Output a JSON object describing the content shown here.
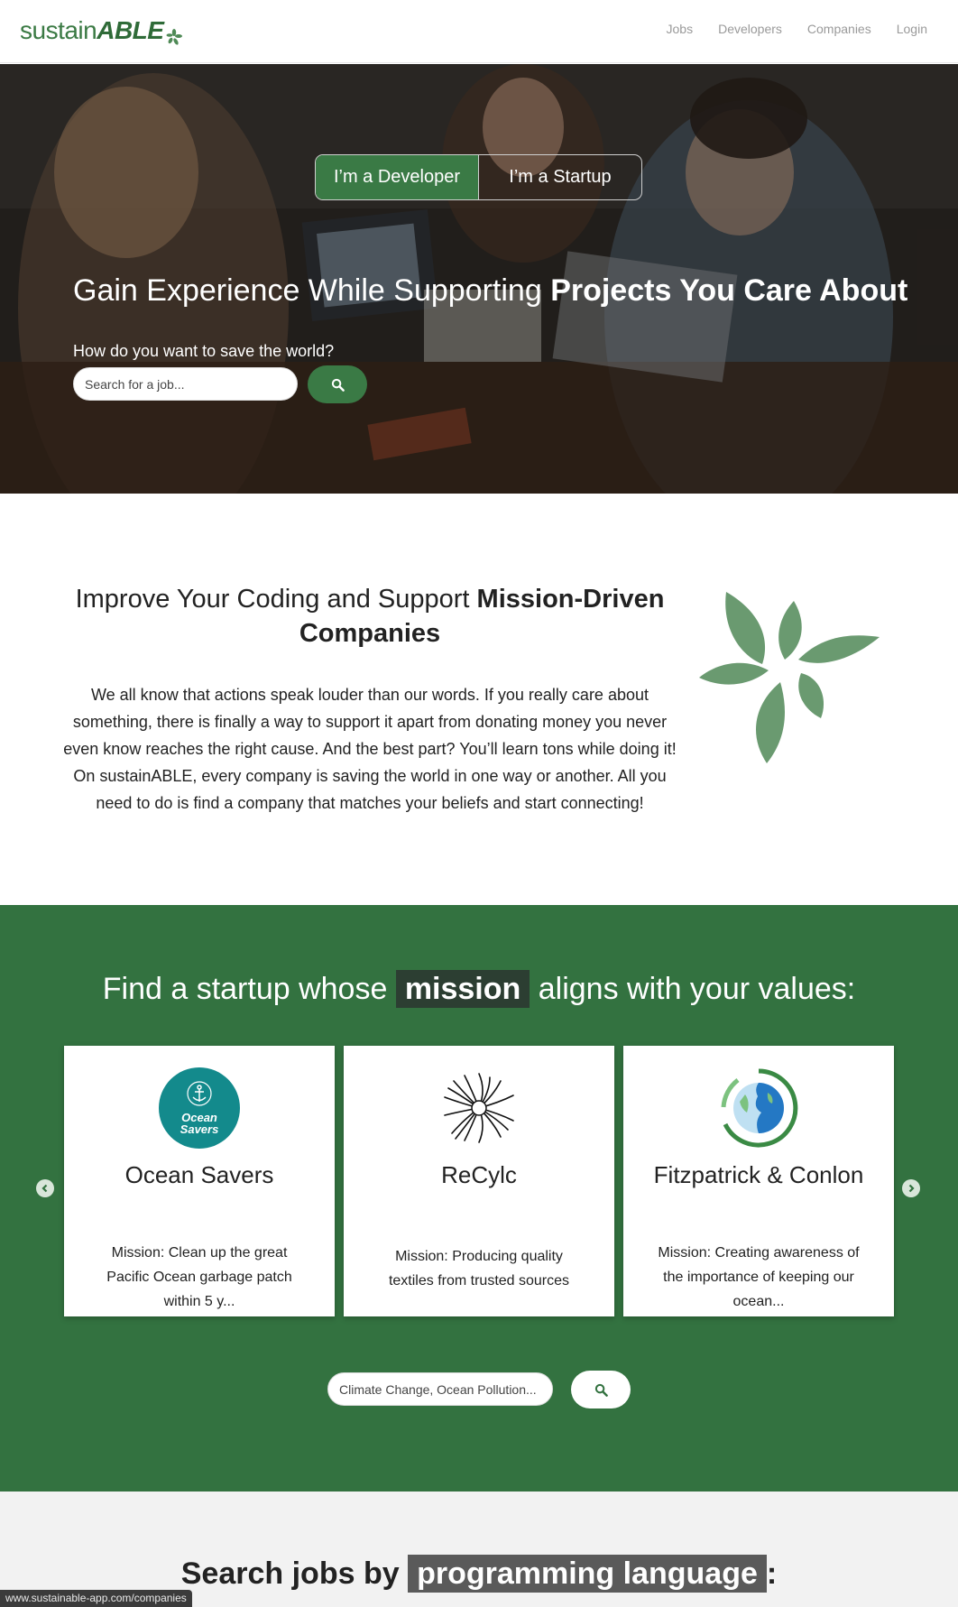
{
  "navbar": {
    "logo_text_light": "sustain",
    "logo_text_strong": "ABLE",
    "links": [
      "Jobs",
      "Developers",
      "Companies",
      "Login"
    ]
  },
  "hero": {
    "toggle": [
      "I’m a Developer",
      "I’m a Startup"
    ],
    "title_light": "Gain Experience While Supporting ",
    "title_strong": "Projects You Care About",
    "subtitle": "How do you want to save the world?",
    "search_placeholder": "Search for a job..."
  },
  "improve": {
    "title_light": "Improve Your Coding and Support ",
    "title_strong": "Mission-Driven Companies",
    "body": "We all know that actions speak louder than our words. If you really care about something, there is finally a way to support it apart from donating money you never even know reaches the right cause. And the best part? You’ll learn tons while doing it! On sustainABLE, every company is saving the world in one way or another. All you need to do is find a company that matches your beliefs and start connecting!"
  },
  "startups": {
    "title_before": "Find a startup whose ",
    "title_highlight": "mission",
    "title_after": " aligns with your values:",
    "cards": [
      {
        "name": "Ocean Savers",
        "logo_text_1": "Ocean",
        "logo_text_2": "Savers",
        "mission": "Mission: Clean up the great Pacific Ocean garbage patch within 5 y..."
      },
      {
        "name": "ReCylc",
        "mission": "Mission: Producing quality textiles from trusted sources"
      },
      {
        "name": "Fitzpatrick & Conlon",
        "mission": "Mission: Creating awareness of the importance of keeping our ocean..."
      }
    ],
    "search_placeholder": "Climate Change, Ocean Pollution..."
  },
  "languages": {
    "title_before": "Search jobs by ",
    "title_highlight": "programming language",
    "title_after": ":"
  },
  "status_bar": {
    "url": "www.sustainable-app.com/companies"
  },
  "colors": {
    "brand_green": "#3a7a45",
    "section_green": "#337240",
    "leaf_green": "#6a9a70"
  },
  "icons": [
    "search-icon",
    "chevron-left-icon",
    "chevron-right-icon",
    "leaf-icon",
    "anchor-icon"
  ]
}
